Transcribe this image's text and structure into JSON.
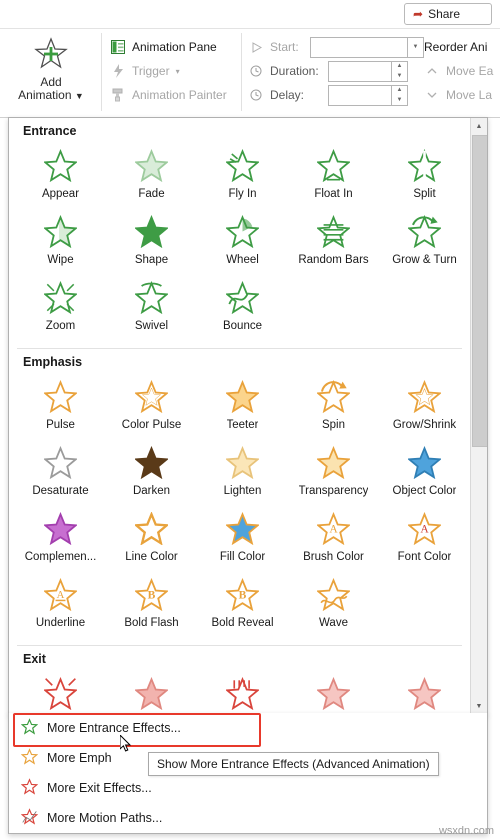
{
  "topbar": {
    "share_label": "Share",
    "share_icon": "share-icon"
  },
  "ribbon": {
    "add_animation": {
      "label_line1": "Add",
      "label_line2": "Animation",
      "caret": "▼"
    },
    "group_advanced": [
      {
        "label": "Animation Pane",
        "icon": "animation-pane-icon",
        "dim": false
      },
      {
        "label": "Trigger",
        "icon": "trigger-icon",
        "caret": "▾",
        "dim": true
      },
      {
        "label": "Animation Painter",
        "icon": "animation-painter-icon",
        "dim": true
      }
    ],
    "timing": {
      "start_label": "Start:",
      "start_value": "",
      "duration_label": "Duration:",
      "duration_value": "",
      "delay_label": "Delay:",
      "delay_value": "",
      "start_icon": "play-icon",
      "duration_icon": "clock-icon",
      "delay_icon": "clock-icon"
    },
    "reorder": {
      "title": "Reorder Ani",
      "move_earlier": "Move Ea",
      "move_later": "Move La"
    }
  },
  "gallery": {
    "sections": [
      {
        "title": "Entrance",
        "items": [
          {
            "label": "Appear",
            "icon": "star-entrance-appear"
          },
          {
            "label": "Fade",
            "icon": "star-entrance-fade"
          },
          {
            "label": "Fly In",
            "icon": "star-entrance-flyin"
          },
          {
            "label": "Float In",
            "icon": "star-entrance-floatin"
          },
          {
            "label": "Split",
            "icon": "star-entrance-split"
          },
          {
            "label": "Wipe",
            "icon": "star-entrance-wipe"
          },
          {
            "label": "Shape",
            "icon": "star-entrance-shape"
          },
          {
            "label": "Wheel",
            "icon": "star-entrance-wheel"
          },
          {
            "label": "Random Bars",
            "icon": "star-entrance-randombars"
          },
          {
            "label": "Grow & Turn",
            "icon": "star-entrance-growturn"
          },
          {
            "label": "Zoom",
            "icon": "star-entrance-zoom"
          },
          {
            "label": "Swivel",
            "icon": "star-entrance-swivel"
          },
          {
            "label": "Bounce",
            "icon": "star-entrance-bounce"
          }
        ]
      },
      {
        "title": "Emphasis",
        "items": [
          {
            "label": "Pulse",
            "icon": "star-emphasis-pulse"
          },
          {
            "label": "Color Pulse",
            "icon": "star-emphasis-colorpulse"
          },
          {
            "label": "Teeter",
            "icon": "star-emphasis-teeter"
          },
          {
            "label": "Spin",
            "icon": "star-emphasis-spin"
          },
          {
            "label": "Grow/Shrink",
            "icon": "star-emphasis-growshrink"
          },
          {
            "label": "Desaturate",
            "icon": "star-emphasis-desaturate"
          },
          {
            "label": "Darken",
            "icon": "star-emphasis-darken"
          },
          {
            "label": "Lighten",
            "icon": "star-emphasis-lighten"
          },
          {
            "label": "Transparency",
            "icon": "star-emphasis-transparency"
          },
          {
            "label": "Object Color",
            "icon": "star-emphasis-objectcolor"
          },
          {
            "label": "Complemen...",
            "icon": "star-emphasis-complementary"
          },
          {
            "label": "Line Color",
            "icon": "star-emphasis-linecolor"
          },
          {
            "label": "Fill Color",
            "icon": "star-emphasis-fillcolor"
          },
          {
            "label": "Brush Color",
            "icon": "star-emphasis-brushcolor"
          },
          {
            "label": "Font Color",
            "icon": "star-emphasis-fontcolor"
          },
          {
            "label": "Underline",
            "icon": "star-emphasis-underline"
          },
          {
            "label": "Bold Flash",
            "icon": "star-emphasis-boldflash"
          },
          {
            "label": "Bold Reveal",
            "icon": "star-emphasis-boldreveal"
          },
          {
            "label": "Wave",
            "icon": "star-emphasis-wave"
          }
        ]
      },
      {
        "title": "Exit",
        "items": [
          {
            "label": "",
            "icon": "star-exit-1"
          },
          {
            "label": "",
            "icon": "star-exit-2"
          },
          {
            "label": "",
            "icon": "star-exit-3"
          },
          {
            "label": "",
            "icon": "star-exit-4"
          },
          {
            "label": "",
            "icon": "star-exit-5"
          }
        ]
      }
    ],
    "scrollbar": {
      "up": "▲",
      "down": "▼"
    }
  },
  "menu": {
    "items": [
      {
        "label": "More Entrance Effects...",
        "icon": "star-green-icon",
        "highlighted": true
      },
      {
        "label": "More Emph",
        "icon": "star-yellow-icon",
        "highlighted": false
      },
      {
        "label": "More Exit Effects...",
        "icon": "star-red-icon",
        "highlighted": false
      },
      {
        "label": "More Motion Paths...",
        "icon": "star-star-icon",
        "highlighted": false
      }
    ]
  },
  "tooltip": {
    "text": "Show More Entrance Effects (Advanced Animation)"
  },
  "watermark": {
    "text": "wsxdn.com"
  },
  "colors": {
    "entrance_green": "#46a04a",
    "emphasis_yellow": "#eda73b",
    "exit_red": "#e05b52",
    "highlight_red": "#e8392b",
    "accent_share": "#c0392b"
  }
}
